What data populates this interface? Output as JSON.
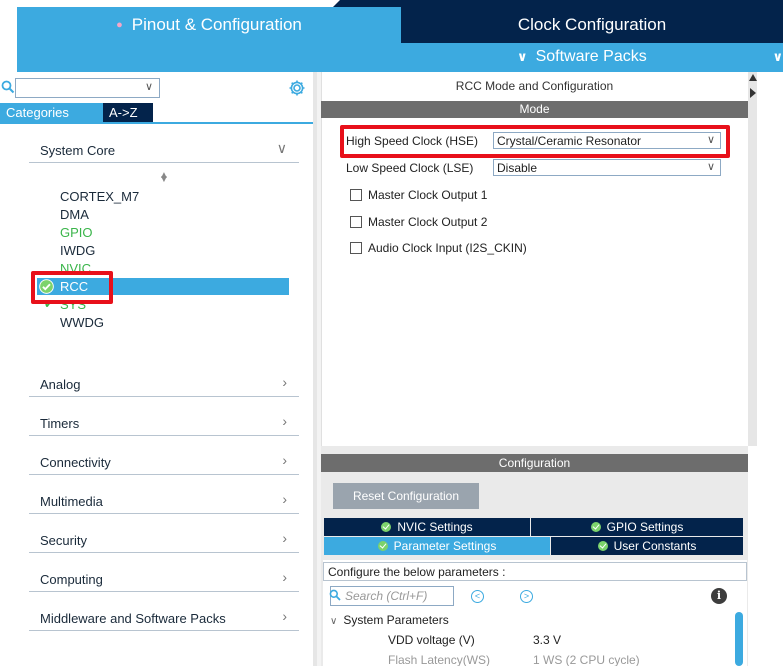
{
  "header": {
    "tabs": [
      {
        "label": "Pinout & Configuration",
        "active": true
      },
      {
        "label": "Clock Configuration",
        "active": false
      }
    ],
    "software_packs_label": "Software Packs"
  },
  "left_panel": {
    "search_value": "",
    "category_tabs": [
      "Categories",
      "A->Z"
    ],
    "categories": [
      {
        "label": "System Core",
        "expanded": true
      },
      {
        "label": "Analog"
      },
      {
        "label": "Timers"
      },
      {
        "label": "Connectivity"
      },
      {
        "label": "Multimedia"
      },
      {
        "label": "Security"
      },
      {
        "label": "Computing"
      },
      {
        "label": "Middleware and Software Packs"
      }
    ],
    "system_core_items": [
      {
        "label": "CORTEX_M7",
        "status": "none"
      },
      {
        "label": "DMA",
        "status": "none"
      },
      {
        "label": "GPIO",
        "status": "configured"
      },
      {
        "label": "IWDG",
        "status": "none"
      },
      {
        "label": "NVIC",
        "status": "configured"
      },
      {
        "label": "RCC",
        "status": "selected"
      },
      {
        "label": "SYS",
        "status": "configured"
      },
      {
        "label": "WWDG",
        "status": "none"
      }
    ]
  },
  "mode_panel": {
    "title": "RCC Mode and Configuration",
    "section_label": "Mode",
    "hse": {
      "label": "High Speed Clock (HSE)",
      "value": "Crystal/Ceramic Resonator"
    },
    "lse": {
      "label": "Low Speed Clock (LSE)",
      "value": "Disable"
    },
    "checkboxes": [
      {
        "label": "Master Clock Output 1",
        "checked": false
      },
      {
        "label": "Master Clock Output 2",
        "checked": false
      },
      {
        "label": "Audio Clock Input (I2S_CKIN)",
        "checked": false
      }
    ]
  },
  "config_panel": {
    "section_label": "Configuration",
    "reset_button": "Reset Configuration",
    "tabs": [
      {
        "label": "NVIC Settings",
        "active": false
      },
      {
        "label": "GPIO Settings",
        "active": false
      },
      {
        "label": "Parameter Settings",
        "active": true
      },
      {
        "label": "User Constants",
        "active": false
      }
    ],
    "instruction": "Configure the below parameters :",
    "search_placeholder": "Search (Ctrl+F)",
    "group_label": "System Parameters",
    "params": [
      {
        "name": "VDD voltage (V)",
        "value": "3.3 V"
      },
      {
        "name": "Flash Latency(WS)",
        "value": "1 WS (2 CPU cycle)"
      }
    ]
  },
  "colors": {
    "accent_blue": "#3caae0",
    "navy": "#03234b",
    "highlight_red": "#e8101a",
    "status_green": "#3ab54a"
  }
}
